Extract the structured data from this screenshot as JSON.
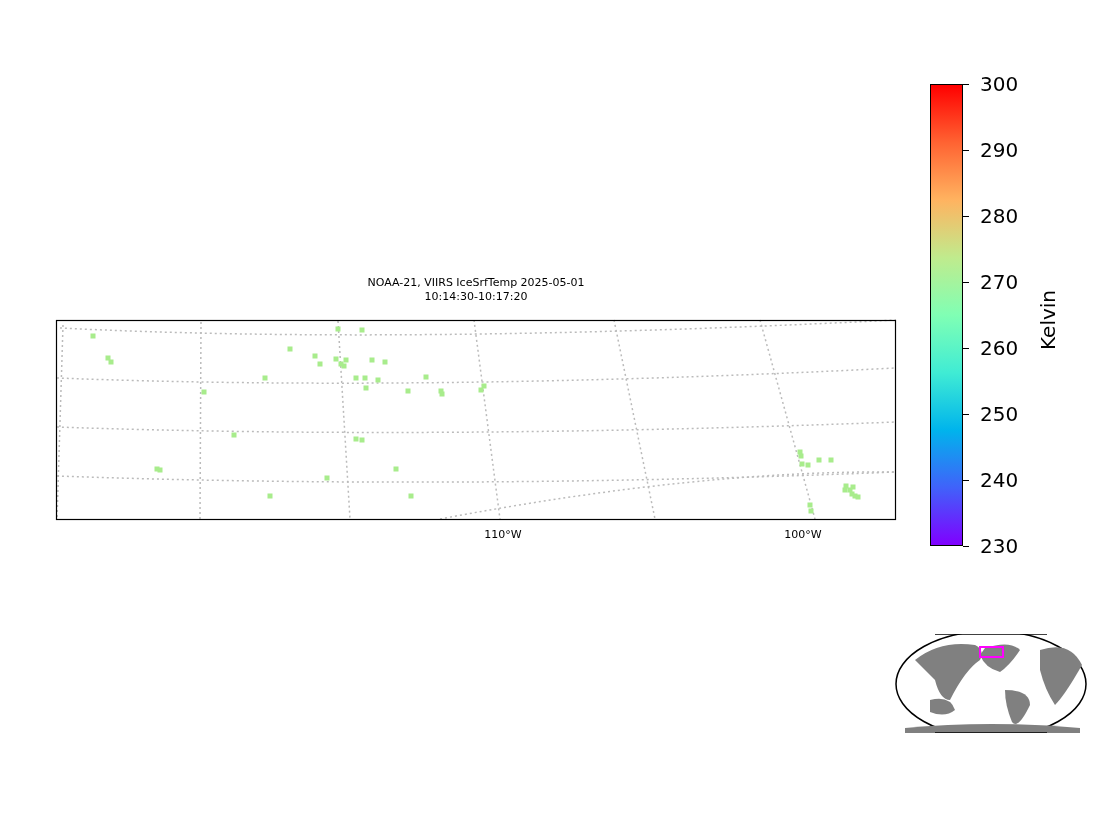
{
  "map": {
    "title": "NOAA-21, VIIRS IceSrfTemp 2025-05-01",
    "subtitle": "10:14:30-10:17:20",
    "xtick_labels": [
      {
        "label": "110°W"
      },
      {
        "label": "100°W"
      }
    ]
  },
  "colorbar": {
    "label": "Kelvin",
    "ticks": [
      "300",
      "290",
      "280",
      "270",
      "260",
      "250",
      "240",
      "230"
    ]
  }
}
